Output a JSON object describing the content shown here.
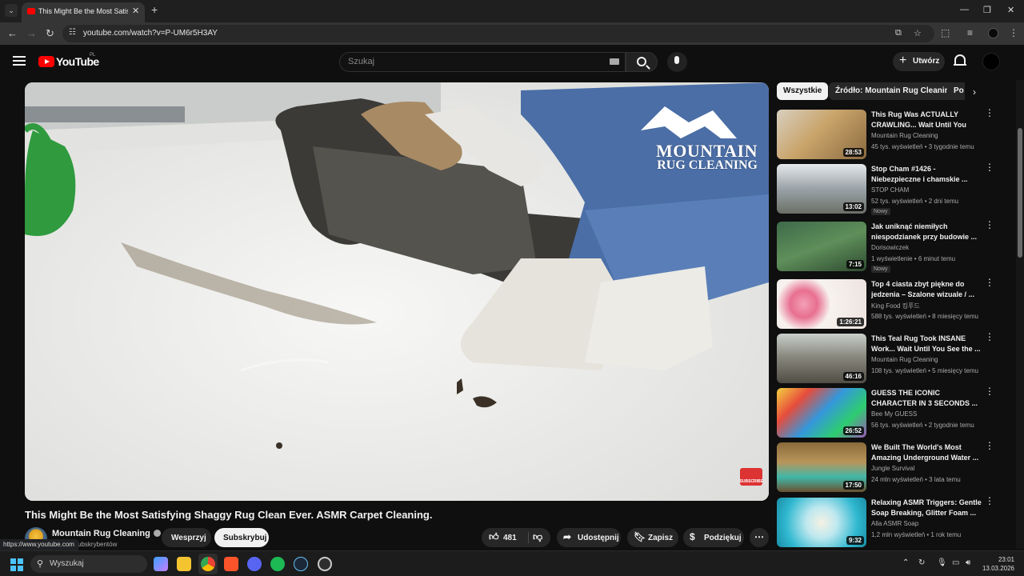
{
  "browser": {
    "tab_title": "This Might Be the Most Satisfying Shaggy Rug Clean Ever. ASMR Carpet Cleaning.",
    "url": "youtube.com/watch?v=P-UM6r5H3AY",
    "status_url": "https://www.youtube.com"
  },
  "masthead": {
    "logo_text": "YouTube",
    "region": "PL",
    "search_placeholder": "Szukaj",
    "create_label": "Utwórz"
  },
  "video": {
    "title": "This Might Be the Most Satisfying Shaggy Rug Clean Ever. ASMR Carpet Cleaning.",
    "watermark_title": "MOUNTAIN",
    "watermark_sub": "RUG CLEANING",
    "subscribe_badge": "SUBSCRIBE",
    "channel": "Mountain Rug Cleaning",
    "subscribers": "ubskrybentów",
    "buttons": {
      "join": "Wesprzyj",
      "subscribe": "Subskrybuj",
      "likes": "481",
      "share": "Udostępnij",
      "save": "Zapisz",
      "thanks": "Podziękuj"
    }
  },
  "sidebar": {
    "chips": [
      "Wszystkie",
      "Źródło: Mountain Rug Cleaning",
      "Po"
    ],
    "recommendations": [
      {
        "title": "This Rug Was ACTUALLY CRAWLING... Wait Until You Se...",
        "channel": "Mountain Rug Cleaning",
        "meta": "45 tys. wyświetleń • 3 tygodnie temu",
        "duration": "28:53",
        "badge": ""
      },
      {
        "title": "Stop Cham #1426 - Niebezpieczne i chamskie ...",
        "channel": "STOP CHAM",
        "meta": "52 tys. wyświetleń • 2 dni temu",
        "duration": "13:02",
        "badge": "Nowy"
      },
      {
        "title": "Jak uniknąć niemiłych niespodzianek przy budowie ...",
        "channel": "Dorisowiczek",
        "meta": "1 wyświetlenie • 6 minut temu",
        "duration": "7:15",
        "badge": "Nowy"
      },
      {
        "title": "Top 4 ciasta zbyt piękne do jedzenia – Szalone wizuale / ...",
        "channel": "King Food 킹푸드",
        "meta": "588 tys. wyświetleń • 8 miesięcy temu",
        "duration": "1:26:21",
        "badge": ""
      },
      {
        "title": "This Teal Rug Took INSANE Work... Wait Until You See the ...",
        "channel": "Mountain Rug Cleaning",
        "meta": "108 tys. wyświetleń • 5 miesięcy temu",
        "duration": "46:16",
        "badge": ""
      },
      {
        "title": "GUESS THE ICONIC CHARACTER IN 3 SECONDS ...",
        "channel": "Bee My GUESS",
        "meta": "56 tys. wyświetleń • 2 tygodnie temu",
        "duration": "26:52",
        "badge": ""
      },
      {
        "title": "We Built The World's Most Amazing Underground Water ...",
        "channel": "Jungle Survival",
        "meta": "24 mln wyświetleń • 3 lata temu",
        "duration": "17:50",
        "badge": ""
      },
      {
        "title": "Relaxing ASMR Triggers: Gentle Soap Breaking, Glitter Foam ...",
        "channel": "Alla ASMR Soap",
        "meta": "1,2 mln wyświetleń • 1 rok temu",
        "duration": "9:32",
        "badge": ""
      }
    ]
  },
  "taskbar": {
    "search_placeholder": "Wyszukaj",
    "time": "23:01",
    "date": "13.03.2026"
  }
}
